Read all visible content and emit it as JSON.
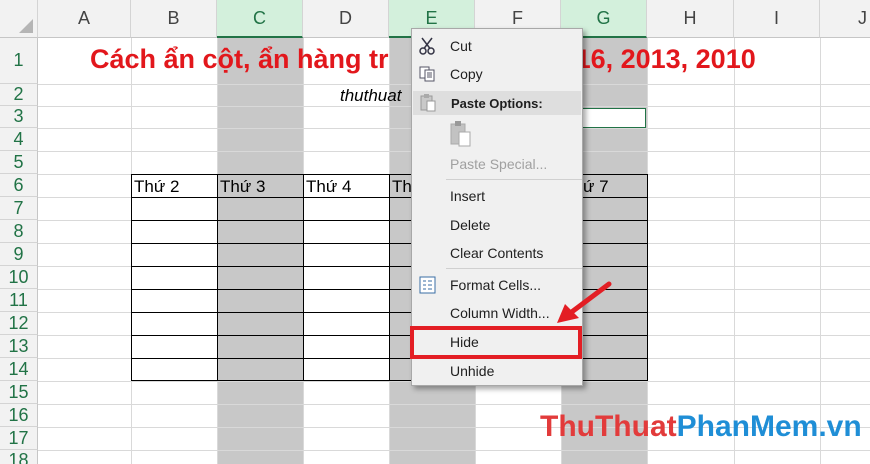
{
  "columns": [
    "A",
    "B",
    "C",
    "D",
    "E",
    "F",
    "G",
    "H",
    "I",
    "J"
  ],
  "rows": [
    "1",
    "2",
    "3",
    "4",
    "5",
    "6",
    "7",
    "8",
    "9",
    "10",
    "11",
    "12",
    "13",
    "14",
    "15",
    "16",
    "17",
    "18"
  ],
  "sheet": {
    "title_visible": "Cách ẩn cột, ẩn hàng tr",
    "title_tail": "016, 2013, 2010",
    "subtitle_visible": "thuthuat",
    "table_headers": [
      "Thứ 2",
      "Thứ 3",
      "Thứ 4",
      "Th",
      "ứ 7"
    ]
  },
  "context_menu": {
    "cut": "Cut",
    "copy": "Copy",
    "paste_options": "Paste Options:",
    "paste_special": "Paste Special...",
    "insert": "Insert",
    "delete": "Delete",
    "clear_contents": "Clear Contents",
    "format_cells": "Format Cells...",
    "column_width": "Column Width...",
    "hide": "Hide",
    "unhide": "Unhide"
  },
  "watermark": {
    "part1": "Thu",
    "part2": "Thuat",
    "part3": "PhanMem",
    "part4": ".vn"
  },
  "colors": {
    "accent_green": "#217346",
    "title_red": "#e2171c",
    "highlight_red": "#e31e24",
    "hidden_col_gray": "#c8c8c8"
  }
}
